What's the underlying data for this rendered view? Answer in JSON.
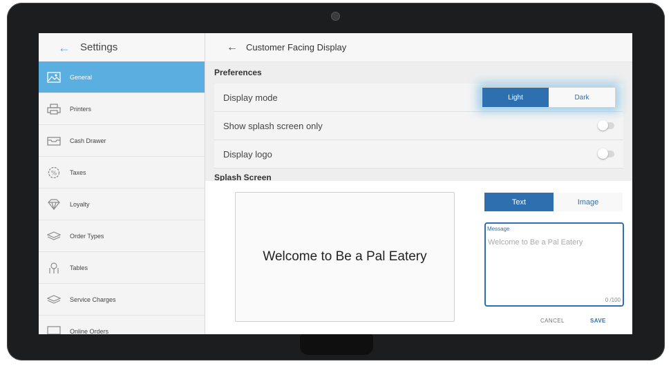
{
  "settings": {
    "title": "Settings",
    "items": [
      {
        "label": "General",
        "icon": "landscape-icon",
        "active": true
      },
      {
        "label": "Printers",
        "icon": "printer-icon",
        "active": false
      },
      {
        "label": "Cash Drawer",
        "icon": "cash-drawer-icon",
        "active": false
      },
      {
        "label": "Taxes",
        "icon": "percent-badge-icon",
        "active": false
      },
      {
        "label": "Loyalty",
        "icon": "diamond-icon",
        "active": false
      },
      {
        "label": "Order Types",
        "icon": "layers-icon",
        "active": false
      },
      {
        "label": "Tables",
        "icon": "tables-icon",
        "active": false
      },
      {
        "label": "Service Charges",
        "icon": "layers-icon",
        "active": false
      },
      {
        "label": "Online Orders",
        "icon": "monitor-icon",
        "active": false
      }
    ]
  },
  "main": {
    "title": "Customer Facing Display",
    "preferences_heading": "Preferences",
    "display_mode": {
      "label": "Display mode",
      "options": [
        "Light",
        "Dark"
      ],
      "selected": "Light"
    },
    "splash_only": {
      "label": "Show splash screen only",
      "on": false
    },
    "display_logo": {
      "label": "Display logo",
      "on": false
    },
    "splash_heading": "Splash Screen",
    "preview_text": "Welcome to Be a Pal Eatery",
    "content_type": {
      "options": [
        "Text",
        "Image"
      ],
      "selected": "Text"
    },
    "message": {
      "label": "Message",
      "value": "Welcome to Be a Pal Eatery",
      "counter": "0 /100"
    },
    "cancel_label": "CANCEL",
    "save_label": "SAVE"
  },
  "colors": {
    "accent": "#5aaee0",
    "primary": "#2e6fb0",
    "bezel": "#1c1d1f"
  }
}
